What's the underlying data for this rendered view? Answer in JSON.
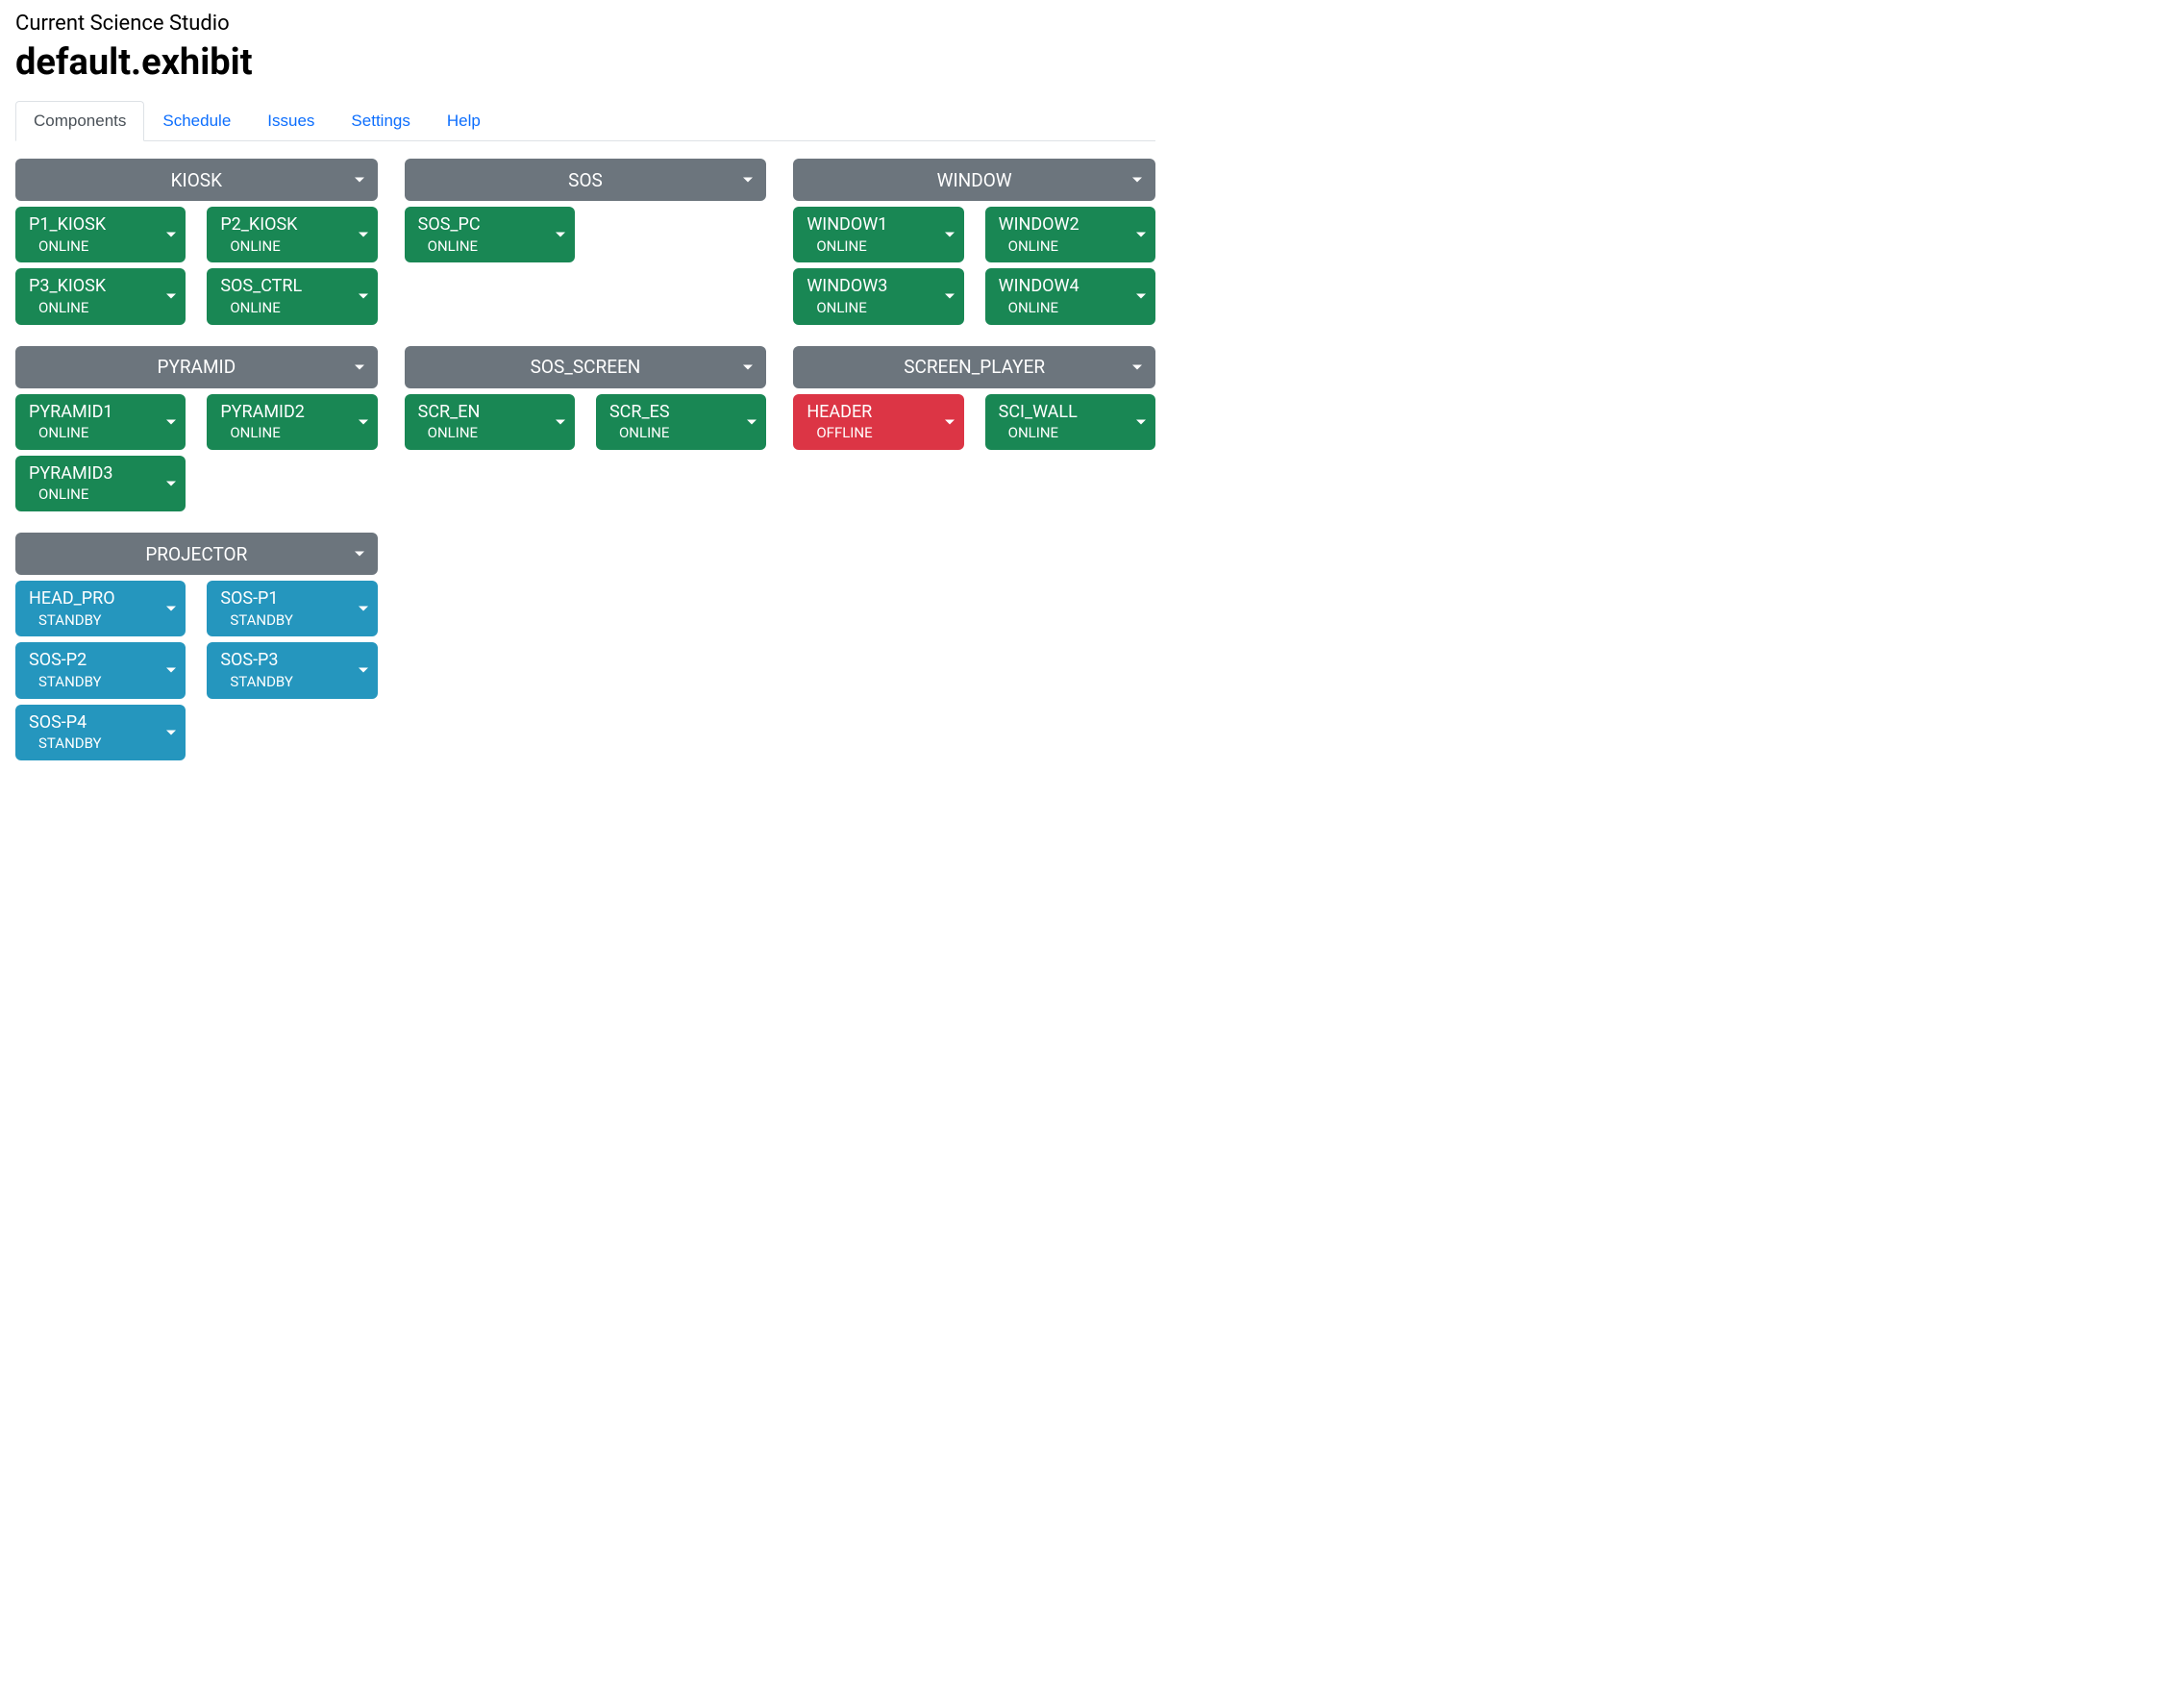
{
  "subtitle": "Current Science Studio",
  "title": "default.exhibit",
  "tabs": [
    {
      "label": "Components",
      "active": true
    },
    {
      "label": "Schedule",
      "active": false
    },
    {
      "label": "Issues",
      "active": false
    },
    {
      "label": "Settings",
      "active": false
    },
    {
      "label": "Help",
      "active": false
    }
  ],
  "status_colors": {
    "ONLINE": "#198754",
    "OFFLINE": "#dc3545",
    "STANDBY": "#2596be"
  },
  "groups": [
    {
      "name": "KIOSK",
      "components": [
        {
          "name": "P1_KIOSK",
          "status": "ONLINE"
        },
        {
          "name": "P2_KIOSK",
          "status": "ONLINE"
        },
        {
          "name": "P3_KIOSK",
          "status": "ONLINE"
        },
        {
          "name": "SOS_CTRL",
          "status": "ONLINE"
        }
      ]
    },
    {
      "name": "SOS",
      "components": [
        {
          "name": "SOS_PC",
          "status": "ONLINE"
        }
      ]
    },
    {
      "name": "WINDOW",
      "components": [
        {
          "name": "WINDOW1",
          "status": "ONLINE"
        },
        {
          "name": "WINDOW2",
          "status": "ONLINE"
        },
        {
          "name": "WINDOW3",
          "status": "ONLINE"
        },
        {
          "name": "WINDOW4",
          "status": "ONLINE"
        }
      ]
    },
    {
      "name": "PYRAMID",
      "components": [
        {
          "name": "PYRAMID1",
          "status": "ONLINE"
        },
        {
          "name": "PYRAMID2",
          "status": "ONLINE"
        },
        {
          "name": "PYRAMID3",
          "status": "ONLINE"
        }
      ]
    },
    {
      "name": "SOS_SCREEN",
      "components": [
        {
          "name": "SCR_EN",
          "status": "ONLINE"
        },
        {
          "name": "SCR_ES",
          "status": "ONLINE"
        }
      ]
    },
    {
      "name": "SCREEN_PLAYER",
      "components": [
        {
          "name": "HEADER",
          "status": "OFFLINE"
        },
        {
          "name": "SCI_WALL",
          "status": "ONLINE"
        }
      ]
    },
    {
      "name": "PROJECTOR",
      "components": [
        {
          "name": "HEAD_PRO",
          "status": "STANDBY"
        },
        {
          "name": "SOS-P1",
          "status": "STANDBY"
        },
        {
          "name": "SOS-P2",
          "status": "STANDBY"
        },
        {
          "name": "SOS-P3",
          "status": "STANDBY"
        },
        {
          "name": "SOS-P4",
          "status": "STANDBY"
        }
      ]
    }
  ]
}
